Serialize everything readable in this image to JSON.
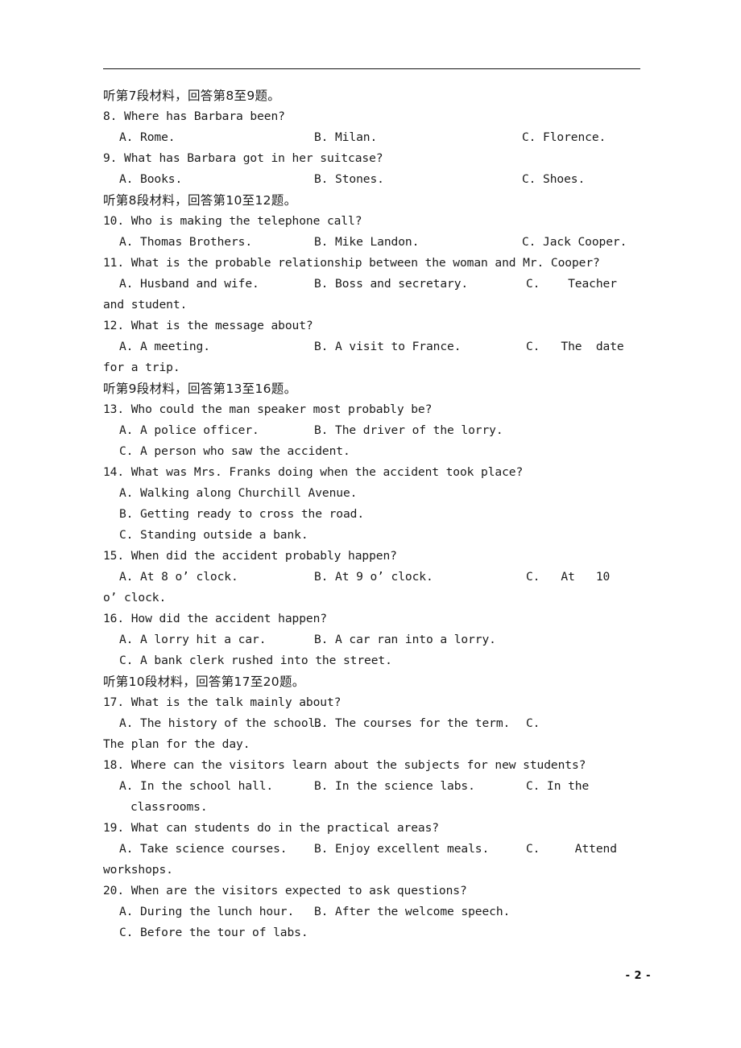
{
  "document": {
    "page_number": "- 2 -",
    "header_rule": true
  },
  "sections": [
    {
      "id": "material-7",
      "heading": "听第7段材料，回答第8至9题。",
      "questions": [
        {
          "number": "8.",
          "stem": "8. Where has Barbara been?",
          "options_row": [
            {
              "label": "A. Rome.",
              "col": "a"
            },
            {
              "label": "B. Milan.",
              "col": "b"
            },
            {
              "label": "C. Florence.",
              "col": "c"
            }
          ]
        },
        {
          "number": "9.",
          "stem": "9. What has Barbara got in her suitcase?",
          "options_row": [
            {
              "label": "A. Books.",
              "col": "a"
            },
            {
              "label": "B. Stones.",
              "col": "b"
            },
            {
              "label": "C. Shoes.",
              "col": "c"
            }
          ]
        }
      ]
    },
    {
      "id": "material-8",
      "heading": "听第8段材料，回答第10至12题。",
      "questions": [
        {
          "number": "10.",
          "stem": "10. Who is making the telephone call?",
          "options_row": [
            {
              "label": "A. Thomas Brothers.",
              "col": "a"
            },
            {
              "label": "B. Mike Landon.",
              "col": "b"
            },
            {
              "label": "C. Jack Cooper.",
              "col": "c"
            }
          ]
        },
        {
          "number": "11.",
          "stem": "11. What is the probable relationship between the woman and Mr. Cooper?",
          "options_row": [
            {
              "label": "A. Husband and wife.",
              "col": "a"
            },
            {
              "label": "B. Boss and secretary.",
              "col": "b"
            },
            {
              "label": "C.    Teacher",
              "col": "c"
            }
          ],
          "continuation": "and student."
        },
        {
          "number": "12.",
          "stem": "12. What is the message about?",
          "options_row": [
            {
              "label": "A. A meeting.",
              "col": "a"
            },
            {
              "label": "B. A visit to France.",
              "col": "b"
            },
            {
              "label": "C.   The  date",
              "col": "c"
            }
          ],
          "continuation": "for a trip."
        }
      ]
    },
    {
      "id": "material-9",
      "heading": "听第9段材料，回答第13至16题。",
      "questions": [
        {
          "number": "13.",
          "stem": "13. Who could the man speaker most probably be?",
          "options_row": [
            {
              "label": "A. A police officer.",
              "col": "a"
            },
            {
              "label": "B. The driver of the lorry.",
              "col": "b"
            }
          ],
          "options_stacked": [
            "C. A person who saw the accident."
          ]
        },
        {
          "number": "14.",
          "stem": "14. What was Mrs. Franks doing when the accident took place?",
          "options_stacked": [
            "A. Walking along Churchill Avenue.",
            "B. Getting ready to cross the road.",
            "C. Standing outside a bank."
          ]
        },
        {
          "number": "15.",
          "stem": "15. When did the accident probably happen?",
          "options_row": [
            {
              "label": "A. At 8 o’ clock.",
              "col": "a"
            },
            {
              "label": "B. At 9 o’ clock.",
              "col": "b"
            },
            {
              "label": "C.   At   10",
              "col": "c"
            }
          ],
          "continuation": "o’ clock."
        },
        {
          "number": "16.",
          "stem": "16. How did the accident happen?",
          "options_row": [
            {
              "label": "A. A lorry hit a car.",
              "col": "a"
            },
            {
              "label": "B. A car ran into a lorry.",
              "col": "b"
            }
          ],
          "options_stacked": [
            "C. A bank clerk rushed into the street."
          ]
        }
      ]
    },
    {
      "id": "material-10",
      "heading": "听第10段材料，回答第17至20题。",
      "questions": [
        {
          "number": "17.",
          "stem": "17. What is the talk mainly about?",
          "options_row": [
            {
              "label": "A. The history of the school.",
              "col": "a"
            },
            {
              "label": "B. The courses for the term.",
              "col": "b"
            },
            {
              "label": "C.",
              "col": "c"
            }
          ],
          "continuation": "The plan for the day."
        },
        {
          "number": "18.",
          "stem": "18. Where can the visitors learn about the subjects for new students?",
          "options_row": [
            {
              "label": "A. In the school hall.",
              "col": "a"
            },
            {
              "label": "B. In the science labs.",
              "col": "b"
            },
            {
              "label": "C. In the",
              "col": "c"
            }
          ],
          "continuation_deep": "classrooms."
        },
        {
          "number": "19.",
          "stem": "19. What can students do in the practical areas?",
          "options_row": [
            {
              "label": "A. Take science courses.",
              "col": "a"
            },
            {
              "label": "B. Enjoy excellent meals.",
              "col": "b"
            },
            {
              "label": "C.     Attend",
              "col": "c"
            }
          ],
          "continuation": "workshops."
        },
        {
          "number": "20.",
          "stem": "20. When are the visitors expected to ask questions?",
          "options_row": [
            {
              "label": "A. During the lunch hour.",
              "col": "a"
            },
            {
              "label": "B. After the welcome speech.",
              "col": "b"
            }
          ],
          "options_stacked": [
            "C. Before the tour of labs."
          ]
        }
      ]
    }
  ]
}
